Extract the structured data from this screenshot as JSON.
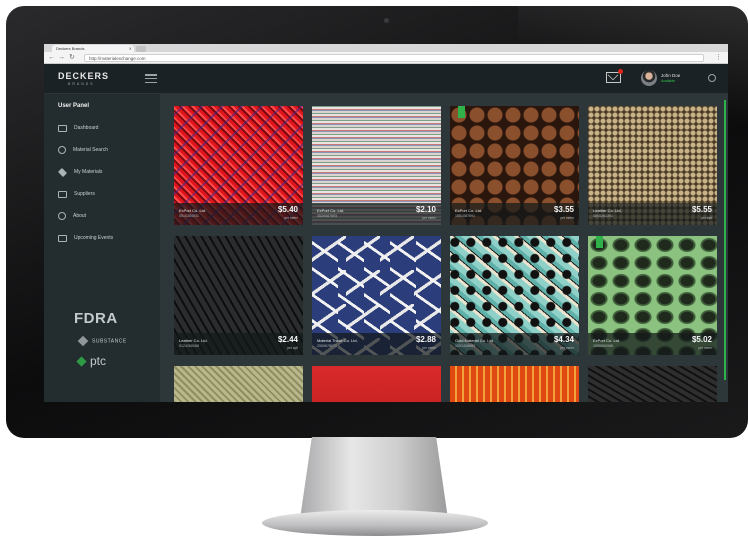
{
  "browser": {
    "tab_title": "Deckers Brands",
    "url": "http://materialexchange.com"
  },
  "header": {
    "logo": "DECKERS",
    "logo_sub": "BRANDS",
    "user_name": "John Doe",
    "user_status": "Available"
  },
  "sidebar": {
    "title": "User Panel",
    "items": [
      {
        "label": "Dashboard",
        "icon": "monitor-icon"
      },
      {
        "label": "Material Search",
        "icon": "search-icon"
      },
      {
        "label": "My Materials",
        "icon": "diamond-icon"
      },
      {
        "label": "Suppliers",
        "icon": "cart-icon"
      },
      {
        "label": "About",
        "icon": "info-icon"
      },
      {
        "label": "Upcoming Events",
        "icon": "calendar-icon"
      }
    ],
    "partners": {
      "fdra": "FDRA",
      "substance": "SUBSTANCE",
      "ptc": "ptc"
    }
  },
  "materials": [
    {
      "supplier": "ExPort Co. Ltd.",
      "code": "0510284931",
      "price": "$5.40",
      "unit": "per meter",
      "bookmarked": false
    },
    {
      "supplier": "ExPort Co. Ltd.",
      "code": "3526087693",
      "price": "$2.10",
      "unit": "per meter",
      "bookmarked": false
    },
    {
      "supplier": "ExPort Co. Ltd.",
      "code": "1551087691",
      "price": "$3.55",
      "unit": "per meter",
      "bookmarked": true
    },
    {
      "supplier": "Leather Co. Ltd.",
      "code": "5805261391",
      "price": "$5.55",
      "unit": "per sqft",
      "bookmarked": false
    },
    {
      "supplier": "Leather Co. Ltd.",
      "code": "0124260088",
      "price": "$2.44",
      "unit": "per sqft",
      "bookmarked": false
    },
    {
      "supplier": "Material Trade Co. Ltd.",
      "code": "2550678071",
      "price": "$2.88",
      "unit": "per meter",
      "bookmarked": false
    },
    {
      "supplier": "Gold Material Co. Ltd.",
      "code": "1551408683",
      "price": "$4.34",
      "unit": "per meter",
      "bookmarked": false
    },
    {
      "supplier": "ExPort Co. Ltd.",
      "code": "1556660988",
      "price": "$5.02",
      "unit": "per meter",
      "bookmarked": true
    }
  ],
  "colors": {
    "accent": "#2fb24a",
    "app_bg": "#2d3639",
    "sidebar_bg": "#232c2f",
    "notification": "#e0251b"
  }
}
